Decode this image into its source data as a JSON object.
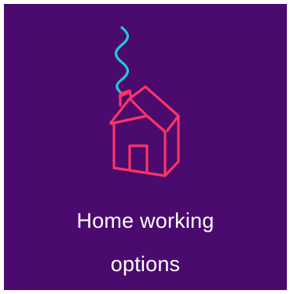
{
  "tile": {
    "label_line1": "Home working",
    "label_line2": "options",
    "icon": "house-with-smoke-icon",
    "colors": {
      "background": "#4b0a6e",
      "house_stroke": "#ff3366",
      "smoke_stroke": "#22c7d9",
      "text": "#ffffff"
    }
  }
}
